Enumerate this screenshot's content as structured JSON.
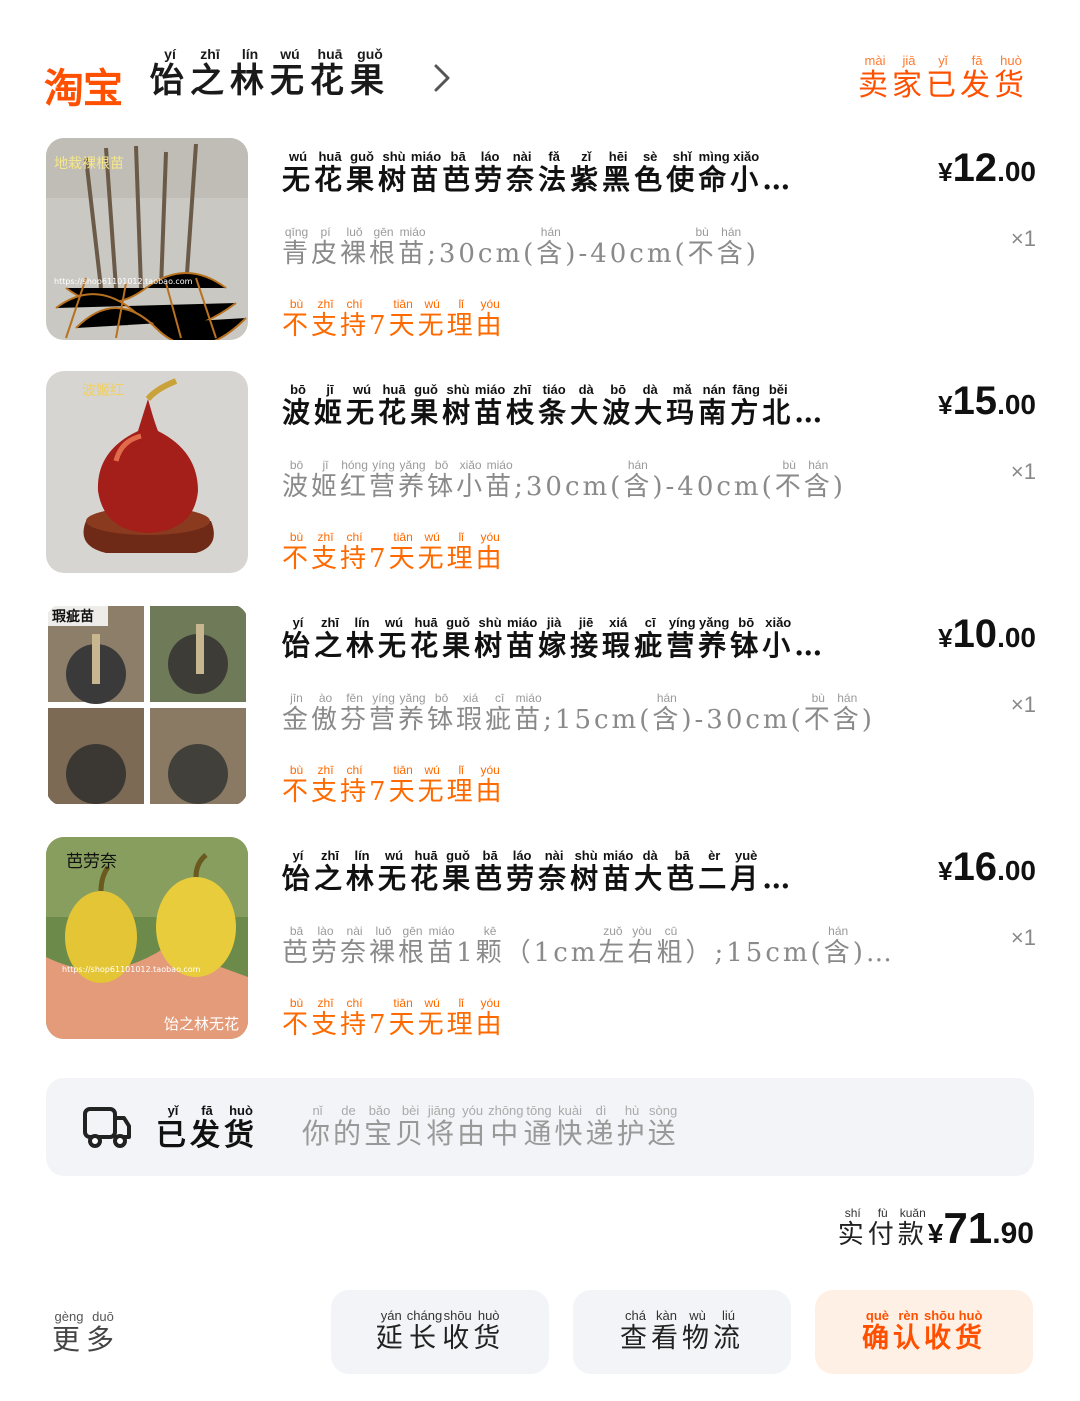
{
  "header": {
    "logo": "淘宝",
    "shop_name": [
      [
        "饴",
        "yí"
      ],
      [
        "之",
        "zhī"
      ],
      [
        "林",
        "lín"
      ],
      [
        "无",
        "wú"
      ],
      [
        "花",
        "huā"
      ],
      [
        "果",
        "guǒ"
      ]
    ],
    "order_status": [
      [
        "卖",
        "mài"
      ],
      [
        "家",
        "jiā"
      ],
      [
        "已",
        "yǐ"
      ],
      [
        "发",
        "fā"
      ],
      [
        "货",
        "huò"
      ]
    ]
  },
  "items": [
    {
      "title": [
        [
          "无",
          "wú"
        ],
        [
          "花",
          "huā"
        ],
        [
          "果",
          "guǒ"
        ],
        [
          "树",
          "shù"
        ],
        [
          "苗",
          "miáo"
        ],
        [
          "芭",
          "bā"
        ],
        [
          "劳",
          "láo"
        ],
        [
          "奈",
          "nài"
        ],
        [
          "法",
          "fǎ"
        ],
        [
          "紫",
          "zǐ"
        ],
        [
          "黑",
          "hēi"
        ],
        [
          "色",
          "sè"
        ],
        [
          "使",
          "shǐ"
        ],
        [
          "命",
          "mìng"
        ],
        [
          "小",
          "xiǎo"
        ],
        [
          "…",
          ""
        ]
      ],
      "price_yuan": "¥",
      "price_int": "12",
      "price_dec": ".00",
      "sku": [
        [
          "青",
          "qīng"
        ],
        [
          "皮",
          "pí"
        ],
        [
          "裸",
          "luǒ"
        ],
        [
          "根",
          "gēn"
        ],
        [
          "苗",
          "miáo"
        ],
        [
          ";30cm(",
          ""
        ],
        [
          "含",
          "hán"
        ],
        [
          ")-40cm(",
          ""
        ],
        [
          "不",
          "bù"
        ],
        [
          "含",
          "hán"
        ],
        [
          ")",
          ""
        ]
      ],
      "qty": "×1",
      "tag": [
        [
          "不",
          "bù"
        ],
        [
          "支",
          "zhī"
        ],
        [
          "持",
          "chí"
        ],
        [
          "7",
          ""
        ],
        [
          "天",
          "tiān"
        ],
        [
          "无",
          "wú"
        ],
        [
          "理",
          "lǐ"
        ],
        [
          "由",
          "yóu"
        ]
      ]
    },
    {
      "title": [
        [
          "波",
          "bō"
        ],
        [
          "姬",
          "jī"
        ],
        [
          "无",
          "wú"
        ],
        [
          "花",
          "huā"
        ],
        [
          "果",
          "guǒ"
        ],
        [
          "树",
          "shù"
        ],
        [
          "苗",
          "miáo"
        ],
        [
          "枝",
          "zhī"
        ],
        [
          "条",
          "tiáo"
        ],
        [
          "大",
          "dà"
        ],
        [
          "波",
          "bō"
        ],
        [
          "大",
          "dà"
        ],
        [
          "玛",
          "mǎ"
        ],
        [
          "南",
          "nán"
        ],
        [
          "方",
          "fāng"
        ],
        [
          "北",
          "běi"
        ],
        [
          "…",
          ""
        ]
      ],
      "price_yuan": "¥",
      "price_int": "15",
      "price_dec": ".00",
      "sku": [
        [
          "波",
          "bō"
        ],
        [
          "姬",
          "jī"
        ],
        [
          "红",
          "hóng"
        ],
        [
          "营",
          "yíng"
        ],
        [
          "养",
          "yǎng"
        ],
        [
          "钵",
          "bō"
        ],
        [
          "小",
          "xiǎo"
        ],
        [
          "苗",
          "miáo"
        ],
        [
          ";30cm(",
          ""
        ],
        [
          "含",
          "hán"
        ],
        [
          ")-40cm(",
          ""
        ],
        [
          "不",
          "bù"
        ],
        [
          "含",
          "hán"
        ],
        [
          ")",
          ""
        ]
      ],
      "qty": "×1",
      "tag": [
        [
          "不",
          "bù"
        ],
        [
          "支",
          "zhī"
        ],
        [
          "持",
          "chí"
        ],
        [
          "7",
          ""
        ],
        [
          "天",
          "tiān"
        ],
        [
          "无",
          "wú"
        ],
        [
          "理",
          "lǐ"
        ],
        [
          "由",
          "yóu"
        ]
      ]
    },
    {
      "title": [
        [
          "饴",
          "yí"
        ],
        [
          "之",
          "zhī"
        ],
        [
          "林",
          "lín"
        ],
        [
          "无",
          "wú"
        ],
        [
          "花",
          "huā"
        ],
        [
          "果",
          "guǒ"
        ],
        [
          "树",
          "shù"
        ],
        [
          "苗",
          "miáo"
        ],
        [
          "嫁",
          "jià"
        ],
        [
          "接",
          "jiē"
        ],
        [
          "瑕",
          "xiá"
        ],
        [
          "疵",
          "cī"
        ],
        [
          "营",
          "yíng"
        ],
        [
          "养",
          "yǎng"
        ],
        [
          "钵",
          "bō"
        ],
        [
          "小",
          "xiǎo"
        ],
        [
          "…",
          ""
        ]
      ],
      "price_yuan": "¥",
      "price_int": "10",
      "price_dec": ".00",
      "sku": [
        [
          "金",
          "jīn"
        ],
        [
          "傲",
          "ào"
        ],
        [
          "芬",
          "fēn"
        ],
        [
          "营",
          "yíng"
        ],
        [
          "养",
          "yǎng"
        ],
        [
          "钵",
          "bō"
        ],
        [
          "瑕",
          "xiá"
        ],
        [
          "疵",
          "cī"
        ],
        [
          "苗",
          "miáo"
        ],
        [
          ";15cm(",
          ""
        ],
        [
          "含",
          "hán"
        ],
        [
          ")-30cm(",
          ""
        ],
        [
          "不",
          "bù"
        ],
        [
          "含",
          "hán"
        ],
        [
          ")",
          ""
        ]
      ],
      "qty": "×1",
      "tag": [
        [
          "不",
          "bù"
        ],
        [
          "支",
          "zhī"
        ],
        [
          "持",
          "chí"
        ],
        [
          "7",
          ""
        ],
        [
          "天",
          "tiān"
        ],
        [
          "无",
          "wú"
        ],
        [
          "理",
          "lǐ"
        ],
        [
          "由",
          "yóu"
        ]
      ]
    },
    {
      "title": [
        [
          "饴",
          "yí"
        ],
        [
          "之",
          "zhī"
        ],
        [
          "林",
          "lín"
        ],
        [
          "无",
          "wú"
        ],
        [
          "花",
          "huā"
        ],
        [
          "果",
          "guǒ"
        ],
        [
          "芭",
          "bā"
        ],
        [
          "劳",
          "láo"
        ],
        [
          "奈",
          "nài"
        ],
        [
          "树",
          "shù"
        ],
        [
          "苗",
          "miáo"
        ],
        [
          "大",
          "dà"
        ],
        [
          "芭",
          "bā"
        ],
        [
          "二",
          "èr"
        ],
        [
          "月",
          "yuè"
        ],
        [
          "…",
          ""
        ]
      ],
      "price_yuan": "¥",
      "price_int": "16",
      "price_dec": ".00",
      "sku": [
        [
          "芭",
          "bā"
        ],
        [
          "劳",
          "lào"
        ],
        [
          "奈",
          "nài"
        ],
        [
          "裸",
          "luǒ"
        ],
        [
          "根",
          "gēn"
        ],
        [
          "苗",
          "miáo"
        ],
        [
          "1",
          ""
        ],
        [
          "颗",
          "kē"
        ],
        [
          "（1cm",
          ""
        ],
        [
          "左",
          "zuǒ"
        ],
        [
          "右",
          "yòu"
        ],
        [
          "粗",
          "cū"
        ],
        [
          "）;15cm(",
          ""
        ],
        [
          "含",
          "hán"
        ],
        [
          ")…",
          ""
        ]
      ],
      "qty": "×1",
      "tag": [
        [
          "不",
          "bù"
        ],
        [
          "支",
          "zhī"
        ],
        [
          "持",
          "chí"
        ],
        [
          "7",
          ""
        ],
        [
          "天",
          "tiān"
        ],
        [
          "无",
          "wú"
        ],
        [
          "理",
          "lǐ"
        ],
        [
          "由",
          "yóu"
        ]
      ]
    }
  ],
  "thumb_texts": {
    "t1_label": "地栽裸根苗",
    "t1_url": "https://shop61101012.taobao.com",
    "t2_label": "波姬红",
    "t3_label": "瑕疵苗",
    "t4_label": "芭劳奈",
    "t4_url": "https://shop61101012.taobao.com",
    "t4_shop": "饴之林无花"
  },
  "shipping": {
    "status": [
      [
        "已",
        "yǐ"
      ],
      [
        "发",
        "fā"
      ],
      [
        "货",
        "huò"
      ]
    ],
    "message": [
      [
        "你",
        "nǐ"
      ],
      [
        "的",
        "de"
      ],
      [
        "宝",
        "bǎo"
      ],
      [
        "贝",
        "bèi"
      ],
      [
        "将",
        "jiāng"
      ],
      [
        "由",
        "yóu"
      ],
      [
        "中",
        "zhōng"
      ],
      [
        "通",
        "tōng"
      ],
      [
        "快",
        "kuài"
      ],
      [
        "递",
        "dì"
      ],
      [
        "护",
        "hù"
      ],
      [
        "送",
        "sòng"
      ]
    ]
  },
  "total": {
    "label": [
      [
        "实",
        "shí"
      ],
      [
        "付",
        "fù"
      ],
      [
        "款",
        "kuǎn"
      ]
    ],
    "yuan": "¥",
    "int": "71",
    "dec": ".90"
  },
  "actions": {
    "more": [
      [
        "更",
        "gèng"
      ],
      [
        "多",
        "duō"
      ]
    ],
    "extend": [
      [
        "延",
        "yán"
      ],
      [
        "长",
        "cháng"
      ],
      [
        "收",
        "shōu"
      ],
      [
        "货",
        "huò"
      ]
    ],
    "logistics": [
      [
        "查",
        "chá"
      ],
      [
        "看",
        "kàn"
      ],
      [
        "物",
        "wù"
      ],
      [
        "流",
        "liú"
      ]
    ],
    "confirm": [
      [
        "确",
        "què"
      ],
      [
        "认",
        "rèn"
      ],
      [
        "收",
        "shōu"
      ],
      [
        "货",
        "huò"
      ]
    ]
  },
  "colors": {
    "accent": "#ff5000",
    "tag": "#ff6a00",
    "panel": "#f2f4f7"
  },
  "icons": {
    "chevron": "chevron-right-icon",
    "truck": "truck-icon"
  }
}
